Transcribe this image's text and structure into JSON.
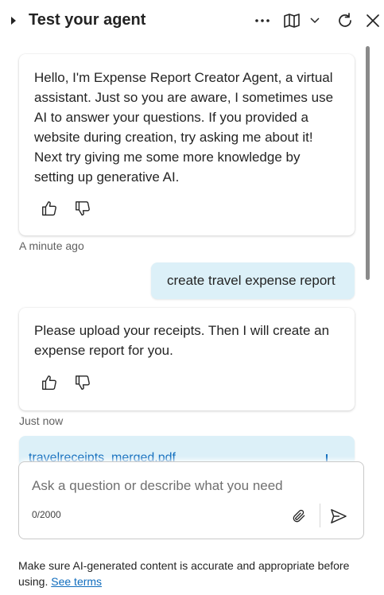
{
  "header": {
    "title": "Test your agent",
    "icons": [
      "caret-right-icon",
      "more-options-icon",
      "map-icon",
      "chevron-down-icon",
      "refresh-icon",
      "close-icon"
    ]
  },
  "messages": {
    "welcome": {
      "text": "Hello, I'm Expense Report Creator Agent, a virtual assistant. Just so you are aware, I sometimes use AI to answer your questions. If you provided a website during creation, try asking me about it! Next try giving me some more knowledge by setting up generative AI.",
      "time": "A minute ago"
    },
    "user": {
      "text": "create travel expense report"
    },
    "upload": {
      "text": "Please upload your receipts. Then I will create an expense report for you.",
      "time": "Just now"
    },
    "attachment": {
      "filename": "travelreceipts_merged.pdf"
    }
  },
  "composer": {
    "placeholder": "Ask a question or describe what you need",
    "counter": "0/2000"
  },
  "disclaimer": {
    "text": "Make sure AI-generated content is accurate and appropriate before using.",
    "link": "See terms"
  },
  "colors": {
    "accent": "#0f6cbd",
    "user_bubble": "#dcf0f8",
    "text": "#242424"
  }
}
